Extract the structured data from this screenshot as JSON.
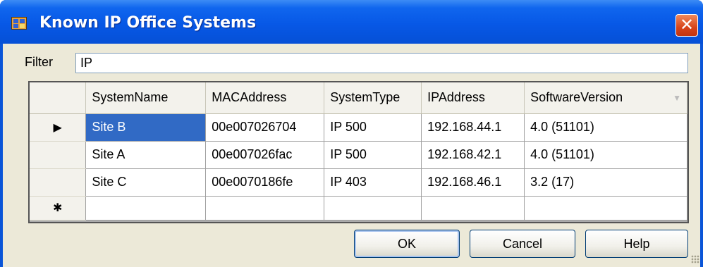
{
  "window": {
    "title": "Known IP Office Systems",
    "close_glyph": "✕"
  },
  "filter": {
    "label": "Filter",
    "value": "IP"
  },
  "grid": {
    "columns": [
      "SystemName",
      "MACAddress",
      "SystemType",
      "IPAddress",
      "SoftwareVersion"
    ],
    "current_row_glyph": "▶",
    "new_row_glyph": "✱",
    "rows": [
      [
        "Site B",
        "00e007026704",
        "IP 500",
        "192.168.44.1",
        "4.0 (51101)"
      ],
      [
        "Site A",
        "00e007026fac",
        "IP 500",
        "192.168.42.1",
        "4.0 (51101)"
      ],
      [
        "Site C",
        "00e0070186fe",
        "IP 403",
        "192.168.46.1",
        "3.2 (17)"
      ]
    ]
  },
  "buttons": {
    "ok": "OK",
    "cancel": "Cancel",
    "help": "Help"
  },
  "icons": {
    "app": "app-window-icon",
    "close": "close-icon",
    "current_row": "current-row-arrow-icon",
    "new_row": "new-row-asterisk-icon",
    "sort": "sort-dropdown-icon",
    "grip": "resize-grip-icon"
  },
  "colors": {
    "titlebar": "#0758e6",
    "close_button": "#d8441a",
    "selection": "#316ac5",
    "dialog_face": "#ece9d8"
  }
}
